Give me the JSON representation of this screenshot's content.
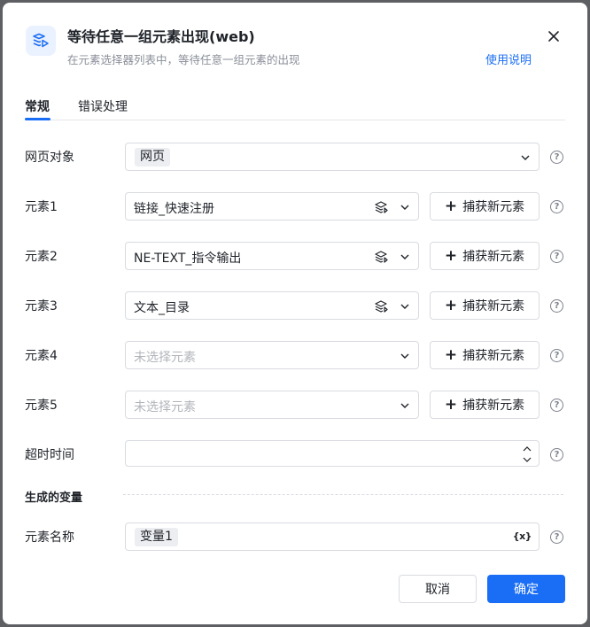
{
  "dialog": {
    "title": "等待任意一组元素出现(web)",
    "subtitle": "在元素选择器列表中，等待任意一组元素的出现",
    "help_link": "使用说明"
  },
  "tabs": [
    {
      "label": "常规",
      "active": true
    },
    {
      "label": "错误处理",
      "active": false
    }
  ],
  "web_object": {
    "label": "网页对象",
    "value": "网页"
  },
  "capture_label": "捕获新元素",
  "elements": [
    {
      "label": "元素1",
      "value": "链接_快速注册",
      "placeholder": ""
    },
    {
      "label": "元素2",
      "value": "NE-TEXT_指令输出",
      "placeholder": ""
    },
    {
      "label": "元素3",
      "value": "文本_目录",
      "placeholder": ""
    },
    {
      "label": "元素4",
      "value": "",
      "placeholder": "未选择元素"
    },
    {
      "label": "元素5",
      "value": "",
      "placeholder": "未选择元素"
    }
  ],
  "timeout": {
    "label": "超时时间",
    "value": ""
  },
  "generated_vars": {
    "section_title": "生成的变量",
    "label": "元素名称",
    "value": "变量1",
    "var_icon": "{x}"
  },
  "buttons": {
    "cancel": "取消",
    "ok": "确定"
  },
  "colors": {
    "accent": "#1a6ef5",
    "chip_bg": "#eceef1",
    "border": "#d9dbe0"
  }
}
